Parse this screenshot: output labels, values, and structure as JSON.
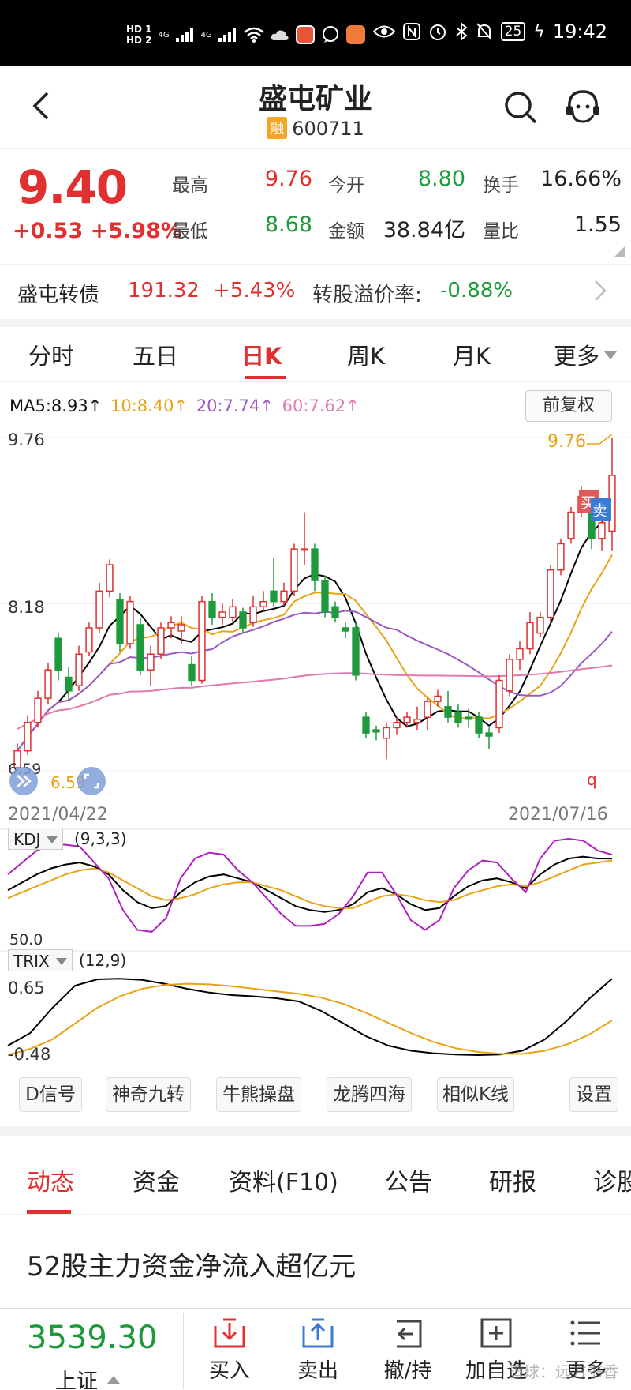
{
  "status_bar": {
    "hd1": "HD 1",
    "hd2": "HD 2",
    "net1": "4G",
    "net2": "4G",
    "battery": "25",
    "time": "19:42",
    "icons": [
      "signal-icon",
      "wifi-icon",
      "cloud-icon",
      "app-icon",
      "chat-icon",
      "heart-app-icon",
      "eye-icon",
      "nfc-icon",
      "alarm-icon",
      "bluetooth-icon",
      "mute-icon",
      "battery-icon",
      "charging-icon"
    ]
  },
  "header": {
    "title": "盛屯矿业",
    "badge": "融",
    "code": "600711"
  },
  "quote": {
    "price": "9.40",
    "change": "+0.53 +5.98%",
    "high_label": "最高",
    "high": "9.76",
    "open_label": "今开",
    "open": "8.80",
    "turnover_label": "换手",
    "turnover": "16.66%",
    "low_label": "最低",
    "low": "8.68",
    "amount_label": "金额",
    "amount": "38.84亿",
    "vol_ratio_label": "量比",
    "vol_ratio": "1.55"
  },
  "bond": {
    "name": "盛屯转债",
    "price": "191.32",
    "change": "+5.43%",
    "premium_label": "转股溢价率:",
    "premium": "-0.88%"
  },
  "tabs": [
    "分时",
    "五日",
    "日K",
    "周K",
    "月K",
    "更多"
  ],
  "chart_header": {
    "ma5": "MA5:8.93↑",
    "ma10": "10:8.40↑",
    "ma20": "20:7.74↑",
    "ma60": "60:7.62↑",
    "adjust_button": "前复权",
    "y_high": "9.76",
    "y_mid": "8.18",
    "y_low": "6.59",
    "max_marker": "9.76",
    "min_marker": "6.59",
    "date_start": "2021/04/22",
    "date_end": "2021/07/16",
    "buy_flag": "买",
    "sell_flag": "卖",
    "q_marker": "q"
  },
  "kdj": {
    "name": "KDJ",
    "params": "(9,3,3)",
    "level": "50.0"
  },
  "trix": {
    "name": "TRIX",
    "params": "(12,9)",
    "top": "0.65",
    "bottom": "-0.48"
  },
  "colors": {
    "up": "#e03030",
    "down": "#1e9a3c",
    "ma5": "#000000",
    "ma10": "#e8a317",
    "ma20": "#9b59c0",
    "ma60": "#e07ab0"
  },
  "chart_data": [
    {
      "type": "candlestick",
      "x_range": [
        "2021/04/22",
        "2021/07/16"
      ],
      "ylim": [
        6.59,
        9.76
      ],
      "y_ticks": [
        9.76,
        8.18
      ],
      "markers": {
        "max": 9.76,
        "min": 6.59
      },
      "series": [
        {
          "name": "MA5",
          "last": 8.93
        },
        {
          "name": "10",
          "last": 8.4
        },
        {
          "name": "20",
          "last": 7.74
        },
        {
          "name": "60",
          "last": 7.62
        }
      ],
      "candles": [
        {
          "o": 6.62,
          "c": 6.78,
          "h": 6.85,
          "l": 6.59
        },
        {
          "o": 6.78,
          "c": 7.05,
          "h": 7.12,
          "l": 6.74
        },
        {
          "o": 7.05,
          "c": 7.28,
          "h": 7.35,
          "l": 7.0
        },
        {
          "o": 7.28,
          "c": 7.55,
          "h": 7.62,
          "l": 7.22
        },
        {
          "o": 7.85,
          "c": 7.55,
          "h": 7.9,
          "l": 7.45
        },
        {
          "o": 7.48,
          "c": 7.35,
          "h": 7.58,
          "l": 7.25
        },
        {
          "o": 7.4,
          "c": 7.7,
          "h": 7.78,
          "l": 7.35
        },
        {
          "o": 7.72,
          "c": 7.95,
          "h": 8.0,
          "l": 7.68
        },
        {
          "o": 7.95,
          "c": 8.3,
          "h": 8.38,
          "l": 7.9
        },
        {
          "o": 8.3,
          "c": 8.55,
          "h": 8.6,
          "l": 8.24
        },
        {
          "o": 8.22,
          "c": 7.8,
          "h": 8.28,
          "l": 7.72
        },
        {
          "o": 7.8,
          "c": 8.2,
          "h": 8.25,
          "l": 7.75
        },
        {
          "o": 7.98,
          "c": 7.55,
          "h": 8.05,
          "l": 7.5
        },
        {
          "o": 7.55,
          "c": 7.7,
          "h": 7.78,
          "l": 7.4
        },
        {
          "o": 7.7,
          "c": 7.95,
          "h": 8.0,
          "l": 7.65
        },
        {
          "o": 7.95,
          "c": 8.0,
          "h": 8.06,
          "l": 7.85
        },
        {
          "o": 7.92,
          "c": 7.98,
          "h": 8.06,
          "l": 7.8
        },
        {
          "o": 7.6,
          "c": 7.45,
          "h": 7.68,
          "l": 7.4
        },
        {
          "o": 7.45,
          "c": 8.2,
          "h": 8.25,
          "l": 7.42
        },
        {
          "o": 8.2,
          "c": 8.05,
          "h": 8.28,
          "l": 7.98
        },
        {
          "o": 8.05,
          "c": 8.1,
          "h": 8.18,
          "l": 7.98
        },
        {
          "o": 8.05,
          "c": 8.15,
          "h": 8.22,
          "l": 8.0
        },
        {
          "o": 8.1,
          "c": 7.95,
          "h": 8.14,
          "l": 7.9
        },
        {
          "o": 8.0,
          "c": 8.15,
          "h": 8.25,
          "l": 7.96
        },
        {
          "o": 8.15,
          "c": 8.2,
          "h": 8.3,
          "l": 8.1
        },
        {
          "o": 8.3,
          "c": 8.2,
          "h": 8.62,
          "l": 8.15
        },
        {
          "o": 8.2,
          "c": 8.3,
          "h": 8.38,
          "l": 8.16
        },
        {
          "o": 8.3,
          "c": 8.7,
          "h": 8.75,
          "l": 8.25
        },
        {
          "o": 8.7,
          "c": 8.7,
          "h": 9.05,
          "l": 8.55
        },
        {
          "o": 8.7,
          "c": 8.4,
          "h": 8.75,
          "l": 8.3
        },
        {
          "o": 8.4,
          "c": 8.1,
          "h": 8.45,
          "l": 8.05
        },
        {
          "o": 8.15,
          "c": 8.05,
          "h": 8.2,
          "l": 8.0
        },
        {
          "o": 7.95,
          "c": 7.92,
          "h": 8.0,
          "l": 7.85
        },
        {
          "o": 7.95,
          "c": 7.5,
          "h": 8.0,
          "l": 7.45
        },
        {
          "o": 7.1,
          "c": 6.95,
          "h": 7.15,
          "l": 6.9
        },
        {
          "o": 6.98,
          "c": 6.96,
          "h": 7.02,
          "l": 6.88
        },
        {
          "o": 6.9,
          "c": 7.0,
          "h": 7.05,
          "l": 6.7
        },
        {
          "o": 7.0,
          "c": 7.05,
          "h": 7.1,
          "l": 6.93
        },
        {
          "o": 7.05,
          "c": 7.1,
          "h": 7.15,
          "l": 7.0
        },
        {
          "o": 7.05,
          "c": 7.08,
          "h": 7.2,
          "l": 6.98
        },
        {
          "o": 7.1,
          "c": 7.25,
          "h": 7.28,
          "l": 6.98
        },
        {
          "o": 7.25,
          "c": 7.3,
          "h": 7.36,
          "l": 7.2
        },
        {
          "o": 7.2,
          "c": 7.1,
          "h": 7.35,
          "l": 7.05
        },
        {
          "o": 7.15,
          "c": 7.05,
          "h": 7.22,
          "l": 7.0
        },
        {
          "o": 7.1,
          "c": 7.08,
          "h": 7.18,
          "l": 7.0
        },
        {
          "o": 7.1,
          "c": 6.95,
          "h": 7.15,
          "l": 6.9
        },
        {
          "o": 6.95,
          "c": 6.92,
          "h": 7.0,
          "l": 6.8
        },
        {
          "o": 7.0,
          "c": 7.45,
          "h": 7.5,
          "l": 6.95
        },
        {
          "o": 7.35,
          "c": 7.65,
          "h": 7.7,
          "l": 7.3
        },
        {
          "o": 7.65,
          "c": 7.75,
          "h": 7.82,
          "l": 7.55
        },
        {
          "o": 7.75,
          "c": 8.0,
          "h": 8.1,
          "l": 7.7
        },
        {
          "o": 7.9,
          "c": 8.05,
          "h": 8.1,
          "l": 7.86
        },
        {
          "o": 8.05,
          "c": 8.5,
          "h": 8.55,
          "l": 8.0
        },
        {
          "o": 8.5,
          "c": 8.75,
          "h": 8.8,
          "l": 8.45
        },
        {
          "o": 8.8,
          "c": 9.05,
          "h": 9.1,
          "l": 8.75
        },
        {
          "o": 9.05,
          "c": 9.2,
          "h": 9.3,
          "l": 9.0
        },
        {
          "o": 9.1,
          "c": 8.8,
          "h": 9.15,
          "l": 8.7
        },
        {
          "o": 8.8,
          "c": 8.95,
          "h": 9.05,
          "l": 8.68
        },
        {
          "o": 8.87,
          "c": 9.4,
          "h": 9.76,
          "l": 8.68
        }
      ]
    },
    {
      "type": "line",
      "name": "KDJ",
      "params": "(9,3,3)",
      "series": [
        {
          "name": "K",
          "values": [
            58,
            66,
            74,
            80,
            84,
            86,
            82,
            74,
            58,
            46,
            40,
            42,
            56,
            66,
            72,
            74,
            70,
            66,
            58,
            50,
            42,
            38,
            36,
            38,
            44,
            56,
            60,
            54,
            44,
            38,
            40,
            52,
            62,
            68,
            70,
            66,
            60,
            74,
            84,
            90,
            92,
            90,
            90
          ]
        },
        {
          "name": "D",
          "values": [
            50,
            56,
            62,
            68,
            74,
            78,
            80,
            76,
            68,
            60,
            52,
            48,
            50,
            54,
            60,
            64,
            66,
            66,
            62,
            58,
            52,
            46,
            42,
            40,
            40,
            46,
            52,
            54,
            52,
            48,
            46,
            48,
            54,
            58,
            62,
            64,
            62,
            66,
            72,
            78,
            84,
            86,
            88
          ]
        },
        {
          "name": "J",
          "values": [
            74,
            86,
            98,
            104,
            104,
            102,
            86,
            70,
            38,
            18,
            16,
            30,
            70,
            90,
            96,
            94,
            78,
            66,
            50,
            34,
            22,
            22,
            24,
            34,
            52,
            76,
            76,
            54,
            28,
            18,
            28,
            60,
            78,
            88,
            86,
            70,
            56,
            90,
            108,
            114,
            108,
            98,
            94
          ]
        }
      ]
    },
    {
      "type": "line",
      "name": "TRIX",
      "params": "(12,9)",
      "ylim": [
        -0.48,
        0.65
      ],
      "series": [
        {
          "name": "TRIX",
          "values": [
            -0.4,
            -0.2,
            0.2,
            0.55,
            0.65,
            0.66,
            0.64,
            0.58,
            0.5,
            0.44,
            0.4,
            0.38,
            0.35,
            0.3,
            0.15,
            -0.05,
            -0.25,
            -0.4,
            -0.48,
            -0.52,
            -0.54,
            -0.55,
            -0.54,
            -0.48,
            -0.3,
            0.0,
            0.35,
            0.66
          ]
        },
        {
          "name": "MATRIX",
          "values": [
            -0.55,
            -0.45,
            -0.3,
            -0.05,
            0.2,
            0.38,
            0.5,
            0.56,
            0.58,
            0.57,
            0.54,
            0.5,
            0.46,
            0.42,
            0.36,
            0.26,
            0.12,
            -0.04,
            -0.2,
            -0.34,
            -0.44,
            -0.5,
            -0.53,
            -0.53,
            -0.48,
            -0.38,
            -0.22,
            0.0
          ]
        }
      ]
    }
  ],
  "tools": [
    "D信号",
    "神奇九转",
    "牛熊操盘",
    "龙腾四海",
    "相似K线",
    "设置"
  ],
  "info_tabs": [
    "动态",
    "资金",
    "资料(F10)",
    "公告",
    "研报",
    "诊股"
  ],
  "headline": "52股主力资金净流入超亿元",
  "bottom": {
    "index_value": "3539.30",
    "index_name": "上证",
    "actions": [
      "买入",
      "卖出",
      "撤/持",
      "加自选",
      "更多"
    ],
    "watermark": "雪球：远方书香"
  }
}
